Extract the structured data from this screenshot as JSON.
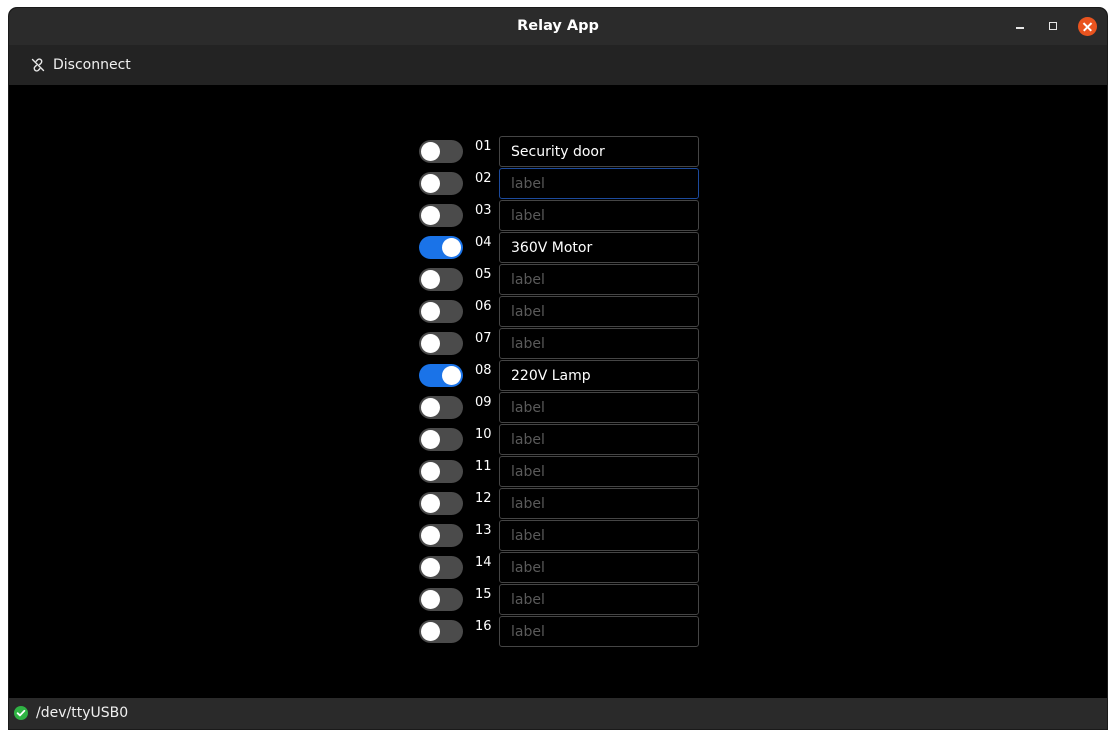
{
  "window": {
    "title": "Relay App"
  },
  "toolbar": {
    "disconnect_label": "Disconnect",
    "disconnect_icon": "unlink-icon"
  },
  "relays": [
    {
      "number": "01",
      "on": false,
      "label": "Security door",
      "placeholder": "label"
    },
    {
      "number": "02",
      "on": false,
      "label": "",
      "placeholder": "label",
      "focused": true
    },
    {
      "number": "03",
      "on": false,
      "label": "",
      "placeholder": "label"
    },
    {
      "number": "04",
      "on": true,
      "label": "360V Motor",
      "placeholder": "label"
    },
    {
      "number": "05",
      "on": false,
      "label": "",
      "placeholder": "label"
    },
    {
      "number": "06",
      "on": false,
      "label": "",
      "placeholder": "label"
    },
    {
      "number": "07",
      "on": false,
      "label": "",
      "placeholder": "label"
    },
    {
      "number": "08",
      "on": true,
      "label": "220V Lamp",
      "placeholder": "label"
    },
    {
      "number": "09",
      "on": false,
      "label": "",
      "placeholder": "label"
    },
    {
      "number": "10",
      "on": false,
      "label": "",
      "placeholder": "label"
    },
    {
      "number": "11",
      "on": false,
      "label": "",
      "placeholder": "label"
    },
    {
      "number": "12",
      "on": false,
      "label": "",
      "placeholder": "label"
    },
    {
      "number": "13",
      "on": false,
      "label": "",
      "placeholder": "label"
    },
    {
      "number": "14",
      "on": false,
      "label": "",
      "placeholder": "label"
    },
    {
      "number": "15",
      "on": false,
      "label": "",
      "placeholder": "label"
    },
    {
      "number": "16",
      "on": false,
      "label": "",
      "placeholder": "label"
    }
  ],
  "status": {
    "port": "/dev/ttyUSB0",
    "connected": true,
    "icon": "check-circle-icon"
  },
  "colors": {
    "accent": "#1a73e8",
    "close": "#e9541f",
    "status_ok": "#2fb344"
  }
}
